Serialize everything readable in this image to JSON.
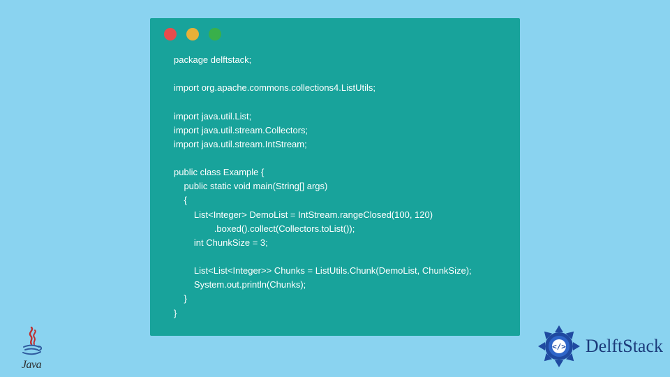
{
  "code_window": {
    "traffic_lights": [
      "red",
      "yellow",
      "green"
    ],
    "code": "package delftstack;\n\nimport org.apache.commons.collections4.ListUtils;\n\nimport java.util.List;\nimport java.util.stream.Collectors;\nimport java.util.stream.IntStream;\n\npublic class Example {\n    public static void main(String[] args)\n    {\n        List<Integer> DemoList = IntStream.rangeClosed(100, 120)\n                .boxed().collect(Collectors.toList());\n        int ChunkSize = 3;\n\n        List<List<Integer>> Chunks = ListUtils.Chunk(DemoList, ChunkSize);\n        System.out.println(Chunks);\n    }\n}"
  },
  "java_logo": {
    "label": "Java"
  },
  "delftstack_logo": {
    "label": "DelftStack"
  },
  "colors": {
    "page_bg": "#8ad3f0",
    "window_bg": "#18a39b",
    "code_fg": "#ffffff",
    "brand_blue": "#1b3a7a",
    "java_red": "#c02e2e"
  }
}
